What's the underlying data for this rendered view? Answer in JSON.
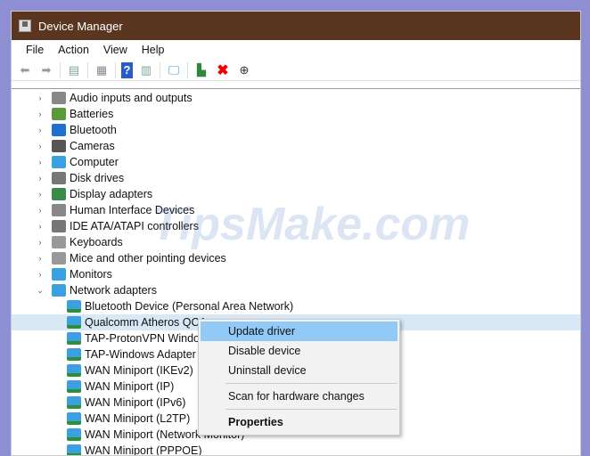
{
  "window": {
    "title": "Device Manager"
  },
  "menubar": [
    "File",
    "Action",
    "View",
    "Help"
  ],
  "toolbar": [
    "back-icon",
    "forward-icon",
    "console-tree-icon",
    "properties-icon",
    "help-icon",
    "action-pane-icon",
    "scan-hardware-icon",
    "update-driver-icon",
    "uninstall-icon",
    "disable-icon"
  ],
  "tree": {
    "categories": [
      {
        "label": "Audio inputs and outputs",
        "icon": "speaker-icon",
        "color": "#888888"
      },
      {
        "label": "Batteries",
        "icon": "battery-icon",
        "color": "#5a9a3a"
      },
      {
        "label": "Bluetooth",
        "icon": "bluetooth-icon",
        "color": "#1e6fd0"
      },
      {
        "label": "Cameras",
        "icon": "camera-icon",
        "color": "#555555"
      },
      {
        "label": "Computer",
        "icon": "computer-icon",
        "color": "#3aa0e0"
      },
      {
        "label": "Disk drives",
        "icon": "disk-icon",
        "color": "#777777"
      },
      {
        "label": "Display adapters",
        "icon": "display-icon",
        "color": "#3a8a4a"
      },
      {
        "label": "Human Interface Devices",
        "icon": "hid-icon",
        "color": "#888888"
      },
      {
        "label": "IDE ATA/ATAPI controllers",
        "icon": "ide-icon",
        "color": "#777777"
      },
      {
        "label": "Keyboards",
        "icon": "keyboard-icon",
        "color": "#999999"
      },
      {
        "label": "Mice and other pointing devices",
        "icon": "mouse-icon",
        "color": "#999999"
      },
      {
        "label": "Monitors",
        "icon": "monitor-icon",
        "color": "#3aa0e0"
      },
      {
        "label": "Network adapters",
        "icon": "network-icon",
        "color": "#3aa0e0",
        "expanded": true
      }
    ],
    "network_children": [
      "Bluetooth Device (Personal Area Network)",
      "Qualcomm Atheros QCA",
      "TAP-ProtonVPN Window",
      "TAP-Windows Adapter V",
      "WAN Miniport (IKEv2)",
      "WAN Miniport (IP)",
      "WAN Miniport (IPv6)",
      "WAN Miniport (L2TP)",
      "WAN Miniport (Network Monitor)",
      "WAN Miniport (PPPOE)"
    ]
  },
  "context_menu": {
    "update": "Update driver",
    "disable": "Disable device",
    "uninstall": "Uninstall device",
    "scan": "Scan for hardware changes",
    "properties": "Properties"
  },
  "watermark": "TipsMake.com"
}
